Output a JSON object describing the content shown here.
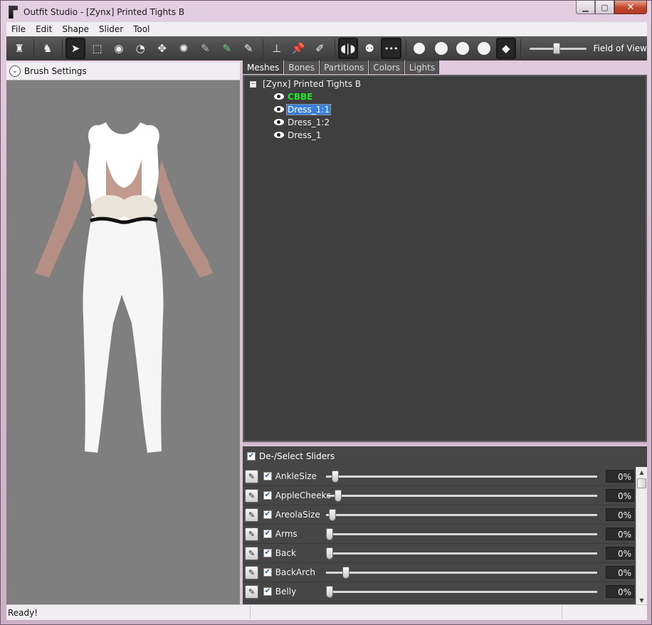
{
  "window": {
    "title": "Outfit Studio - [Zynx] Printed Tights B",
    "controls": [
      "minimize-icon",
      "maximize-icon",
      "close-icon"
    ]
  },
  "menubar": {
    "items": [
      "File",
      "Edit",
      "Shape",
      "Slider",
      "Tool"
    ]
  },
  "toolbar": {
    "fov_label": "Field of View",
    "fov_level": 0.45,
    "buttons": [
      "load-reference-icon",
      "load-outfit-icon",
      "select-brush-icon",
      "mask-brush-icon",
      "inflate-brush-icon",
      "deflate-brush-icon",
      "move-brush-icon",
      "smooth-brush-icon",
      "weight-brush-icon",
      "color-brush-icon",
      "alpha-brush-icon",
      "transform-icon",
      "pivot-icon",
      "vertex-edit-icon",
      "x-mirror-icon",
      "connected-only-icon",
      "global-brush-icon",
      "view-front-icon",
      "view-back-icon",
      "view-left-icon",
      "view-right-icon",
      "perspective-icon"
    ]
  },
  "left_panel": {
    "brush_settings_label": "Brush Settings"
  },
  "tabs": [
    "Meshes",
    "Bones",
    "Partitions",
    "Colors",
    "Lights"
  ],
  "active_tab": "Meshes",
  "mesh_tree": {
    "root": "[Zynx] Printed Tights B",
    "items": [
      {
        "label": "CBBE",
        "reference": true,
        "selected": false
      },
      {
        "label": "Dress_1:1",
        "reference": false,
        "selected": true
      },
      {
        "label": "Dress_1:2",
        "reference": false,
        "selected": false
      },
      {
        "label": "Dress_1",
        "reference": false,
        "selected": false
      }
    ]
  },
  "sliders": {
    "header": "De-/Select Sliders",
    "items": [
      {
        "name": "AnkleSize",
        "value": "0%",
        "position": 0.02
      },
      {
        "name": "AppleCheeks",
        "value": "0%",
        "position": 0.03
      },
      {
        "name": "AreolaSize",
        "value": "0%",
        "position": 0.01
      },
      {
        "name": "Arms",
        "value": "0%",
        "position": 0.0
      },
      {
        "name": "Back",
        "value": "0%",
        "position": 0.0
      },
      {
        "name": "BackArch",
        "value": "0%",
        "position": 0.06
      },
      {
        "name": "Belly",
        "value": "0%",
        "position": 0.0
      }
    ]
  },
  "status": {
    "text": "Ready!"
  },
  "colors": {
    "reference_mesh": "#1ee81e",
    "selection": "#3a7fd9",
    "viewport_bg": "#7f7f7f",
    "tree_bg": "#3f3f3f"
  }
}
